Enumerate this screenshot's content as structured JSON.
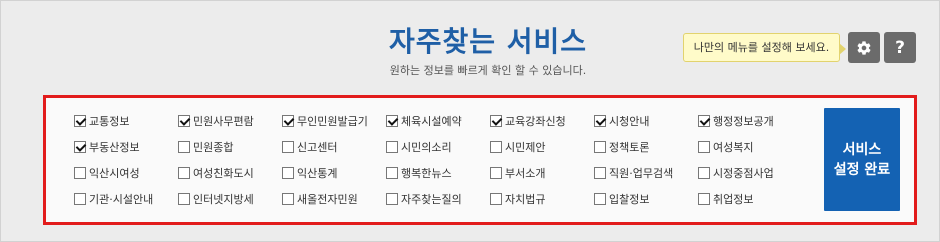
{
  "header": {
    "title": "자주찾는 서비스",
    "subtitle": "원하는 정보를 빠르게 확인 할 수 있습니다."
  },
  "tooltip": {
    "text": "나만의 메뉴를 설정해 보세요."
  },
  "toolbar": {
    "settings_icon": "gear-icon",
    "help_label": "?"
  },
  "services": [
    {
      "label": "교통정보",
      "checked": true
    },
    {
      "label": "민원사무편람",
      "checked": true
    },
    {
      "label": "무인민원발급기",
      "checked": true
    },
    {
      "label": "체육시설예약",
      "checked": true
    },
    {
      "label": "교육강좌신청",
      "checked": true
    },
    {
      "label": "시청안내",
      "checked": true
    },
    {
      "label": "행정정보공개",
      "checked": true
    },
    {
      "label": "부동산정보",
      "checked": true
    },
    {
      "label": "민원종합",
      "checked": false
    },
    {
      "label": "신고센터",
      "checked": false
    },
    {
      "label": "시민의소리",
      "checked": false
    },
    {
      "label": "시민제안",
      "checked": false
    },
    {
      "label": "정책토론",
      "checked": false
    },
    {
      "label": "여성복지",
      "checked": false
    },
    {
      "label": "익산시여성",
      "checked": false
    },
    {
      "label": "여성친화도시",
      "checked": false
    },
    {
      "label": "익산통계",
      "checked": false
    },
    {
      "label": "행복한뉴스",
      "checked": false
    },
    {
      "label": "부서소개",
      "checked": false
    },
    {
      "label": "직원·업무검색",
      "checked": false
    },
    {
      "label": "시정중점사업",
      "checked": false
    },
    {
      "label": "기관·시설안내",
      "checked": false
    },
    {
      "label": "인터넷지방세",
      "checked": false
    },
    {
      "label": "새올전자민원",
      "checked": false
    },
    {
      "label": "자주찾는질의",
      "checked": false
    },
    {
      "label": "자치법규",
      "checked": false
    },
    {
      "label": "입찰정보",
      "checked": false
    },
    {
      "label": "취업정보",
      "checked": false
    }
  ],
  "done_button": {
    "line1": "서비스",
    "line2": "설정 완료"
  },
  "colors": {
    "title": "#1f5fa6",
    "panel_border": "#e21b1b",
    "done_button": "#1462b3",
    "tooltip_bg": "#fffbc9",
    "icon_button": "#6b6b6b"
  }
}
